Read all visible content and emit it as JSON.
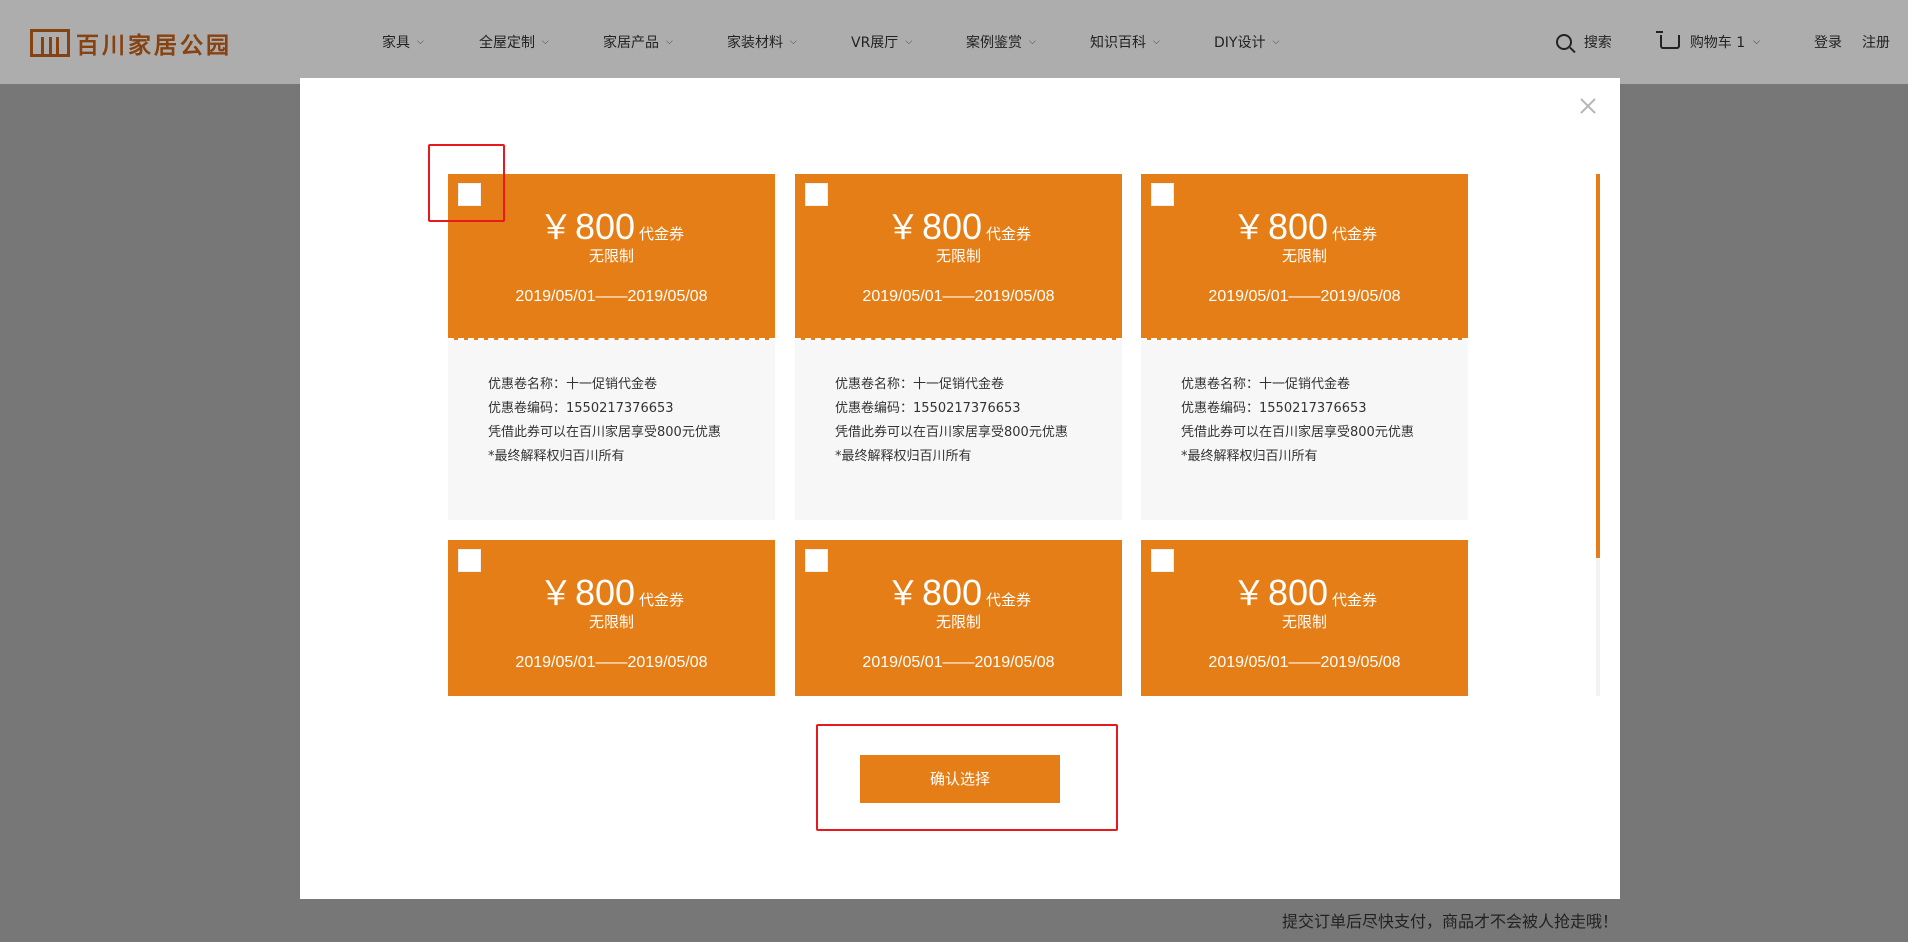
{
  "header": {
    "logo_text": "百川家居公园",
    "nav": [
      {
        "label": "家具"
      },
      {
        "label": "全屋定制"
      },
      {
        "label": "家居产品"
      },
      {
        "label": "家装材料"
      },
      {
        "label": "VR展厅"
      },
      {
        "label": "案例鉴赏"
      },
      {
        "label": "知识百科"
      },
      {
        "label": "DIY设计"
      }
    ],
    "search_label": "搜索",
    "cart_label": "购物车 1",
    "login_label": "登录",
    "register_label": "注册"
  },
  "modal": {
    "coupons": [
      {
        "currency": "￥",
        "amount": "800",
        "kind": "代金券",
        "limit": "无限制",
        "date": "2019/05/01——2019/05/08",
        "name": "优惠卷名称：十一促销代金卷",
        "code": "优惠卷编码：1550217376653",
        "desc": "凭借此券可以在百川家居享受800元优惠",
        "note": "*最终解释权归百川所有"
      },
      {
        "currency": "￥",
        "amount": "800",
        "kind": "代金券",
        "limit": "无限制",
        "date": "2019/05/01——2019/05/08",
        "name": "优惠卷名称：十一促销代金卷",
        "code": "优惠卷编码：1550217376653",
        "desc": "凭借此券可以在百川家居享受800元优惠",
        "note": "*最终解释权归百川所有"
      },
      {
        "currency": "￥",
        "amount": "800",
        "kind": "代金券",
        "limit": "无限制",
        "date": "2019/05/01——2019/05/08",
        "name": "优惠卷名称：十一促销代金卷",
        "code": "优惠卷编码：1550217376653",
        "desc": "凭借此券可以在百川家居享受800元优惠",
        "note": "*最终解释权归百川所有"
      },
      {
        "currency": "￥",
        "amount": "800",
        "kind": "代金券",
        "limit": "无限制",
        "date": "2019/05/01——2019/05/08"
      },
      {
        "currency": "￥",
        "amount": "800",
        "kind": "代金券",
        "limit": "无限制",
        "date": "2019/05/01——2019/05/08"
      },
      {
        "currency": "￥",
        "amount": "800",
        "kind": "代金券",
        "limit": "无限制",
        "date": "2019/05/01——2019/05/08"
      }
    ],
    "confirm_label": "确认选择",
    "accent_color": "#e57e16",
    "highlight_color": "#e8191c"
  },
  "footer_note": "提交订单后尽快支付，商品才不会被人抢走哦！"
}
